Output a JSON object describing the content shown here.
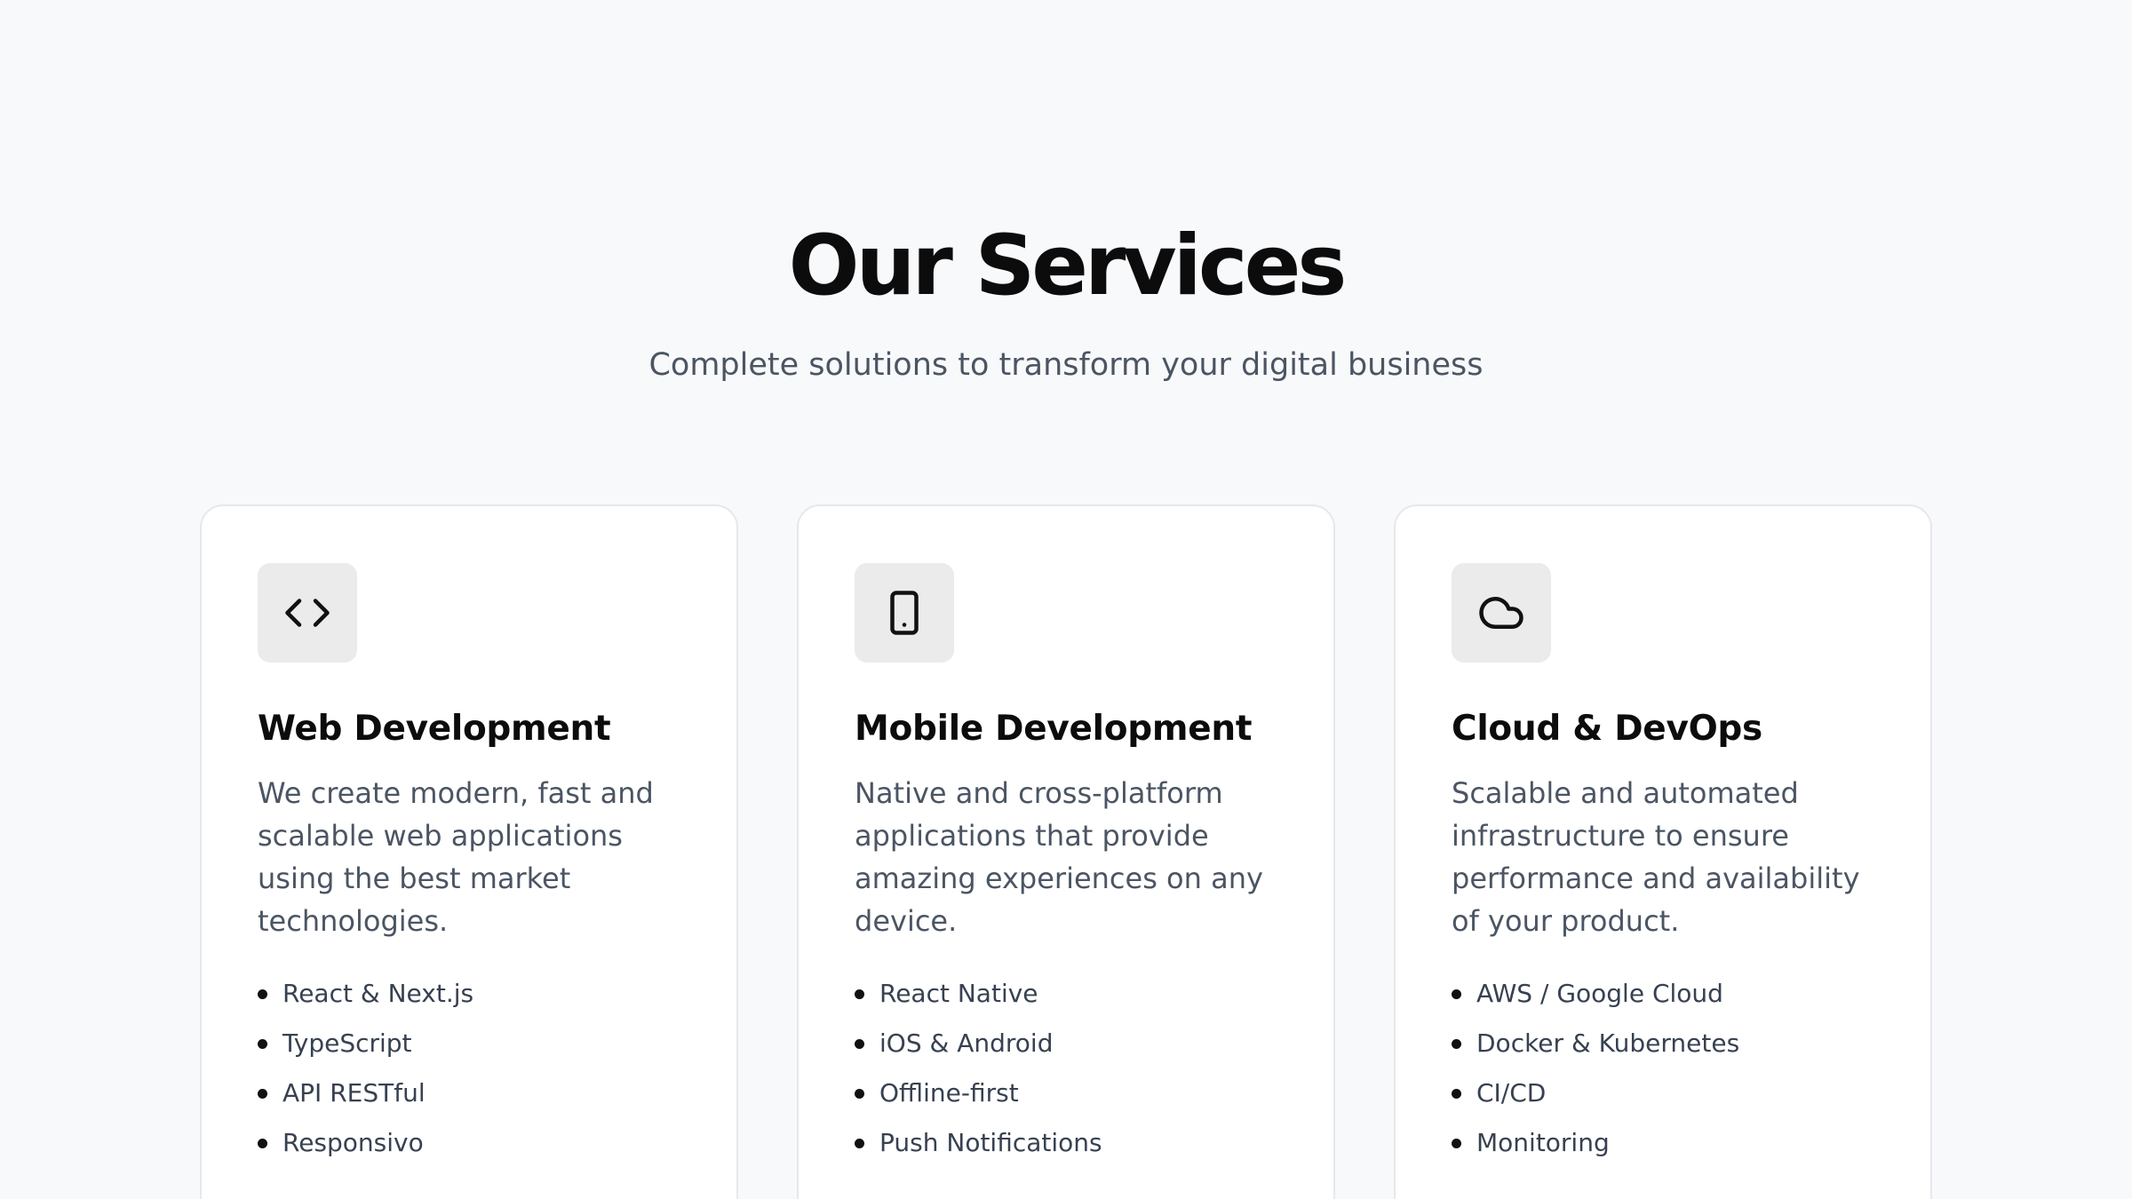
{
  "section": {
    "title": "Our Services",
    "subtitle": "Complete solutions to transform your digital business"
  },
  "services": [
    {
      "icon": "code-icon",
      "title": "Web Development",
      "description": "We create modern, fast and scalable web applications using the best market technologies.",
      "features": [
        "React & Next.js",
        "TypeScript",
        "API RESTful",
        "Responsivo"
      ]
    },
    {
      "icon": "smartphone-icon",
      "title": "Mobile Development",
      "description": "Native and cross-platform applications that provide amazing experiences on any device.",
      "features": [
        "React Native",
        "iOS & Android",
        "Offline-first",
        "Push Notifications"
      ]
    },
    {
      "icon": "cloud-icon",
      "title": "Cloud & DevOps",
      "description": "Scalable and automated infrastructure to ensure performance and availability of your product.",
      "features": [
        "AWS / Google Cloud",
        "Docker & Kubernetes",
        "CI/CD",
        "Monitoring"
      ]
    }
  ],
  "colors": {
    "background": "#f8f9fb",
    "card_background": "#ffffff",
    "icon_background": "#ebebeb",
    "heading": "#0c0c0d",
    "body_text": "#4b5563"
  }
}
